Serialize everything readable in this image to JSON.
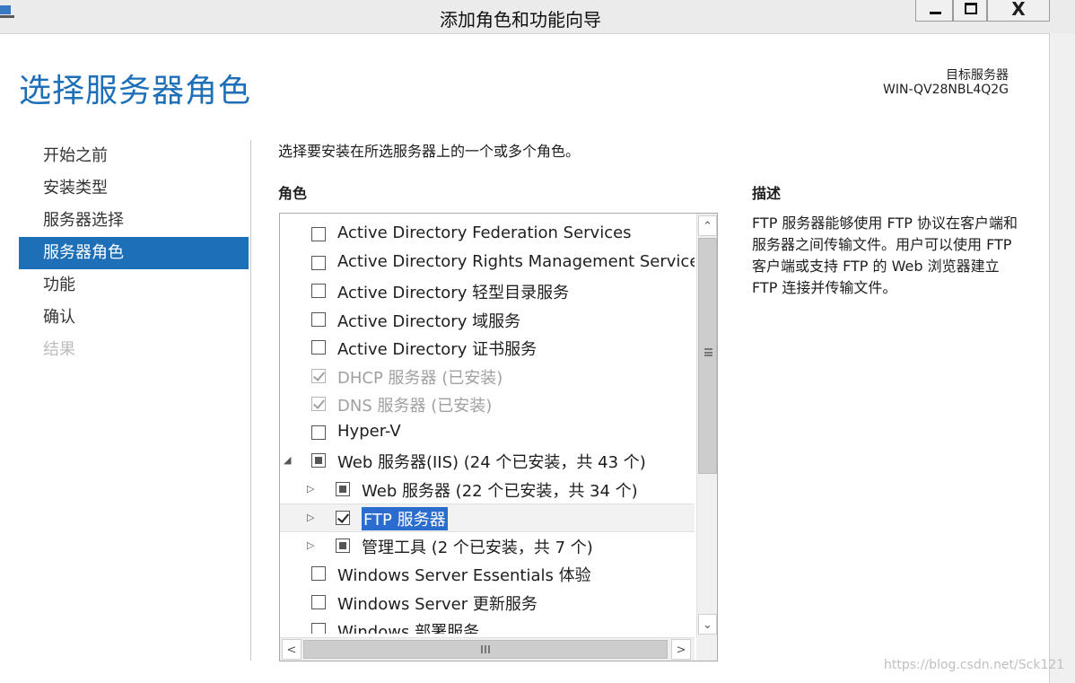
{
  "window": {
    "title": "添加角色和功能向导",
    "close_label": "X"
  },
  "header": {
    "page_title": "选择服务器角色",
    "target_label": "目标服务器",
    "target_value": "WIN-QV28NBL4Q2G"
  },
  "nav": {
    "items": [
      {
        "label": "开始之前"
      },
      {
        "label": "安装类型"
      },
      {
        "label": "服务器选择"
      },
      {
        "label": "服务器角色"
      },
      {
        "label": "功能"
      },
      {
        "label": "确认"
      },
      {
        "label": "结果"
      }
    ],
    "active_index": 3
  },
  "main": {
    "instruction": "选择要安装在所选服务器上的一个或多个角色。",
    "roles_heading": "角色",
    "roles": [
      {
        "label": "Active Directory Federation Services",
        "state": "unchecked"
      },
      {
        "label": "Active Directory Rights Management Services",
        "state": "unchecked"
      },
      {
        "label": "Active Directory 轻型目录服务",
        "state": "unchecked"
      },
      {
        "label": "Active Directory 域服务",
        "state": "unchecked"
      },
      {
        "label": "Active Directory 证书服务",
        "state": "unchecked"
      },
      {
        "label": "DHCP 服务器 (已安装)",
        "state": "checked-disabled"
      },
      {
        "label": "DNS 服务器 (已安装)",
        "state": "checked-disabled"
      },
      {
        "label": "Hyper-V",
        "state": "unchecked"
      },
      {
        "label": "Web 服务器(IIS) (24 个已安装，共 43 个)",
        "state": "partial",
        "expander": "expanded"
      },
      {
        "label": "Web 服务器 (22 个已安装，共 34 个)",
        "state": "partial",
        "expander": "collapsed",
        "child": true
      },
      {
        "label": "FTP 服务器",
        "state": "checked",
        "expander": "collapsed",
        "child": true,
        "selected": true
      },
      {
        "label": "管理工具 (2 个已安装，共 7 个)",
        "state": "partial",
        "expander": "collapsed",
        "child": true
      },
      {
        "label": "Windows Server Essentials 体验",
        "state": "unchecked"
      },
      {
        "label": "Windows Server 更新服务",
        "state": "unchecked"
      },
      {
        "label": "Windows 部署服务",
        "state": "unchecked"
      }
    ]
  },
  "description": {
    "heading": "描述",
    "text": "FTP 服务器能够使用 FTP 协议在客户端和服务器之间传输文件。用户可以使用 FTP 客户端或支持 FTP 的 Web 浏览器建立 FTP 连接并传输文件。"
  },
  "watermark": "https://blog.csdn.net/Sck121"
}
